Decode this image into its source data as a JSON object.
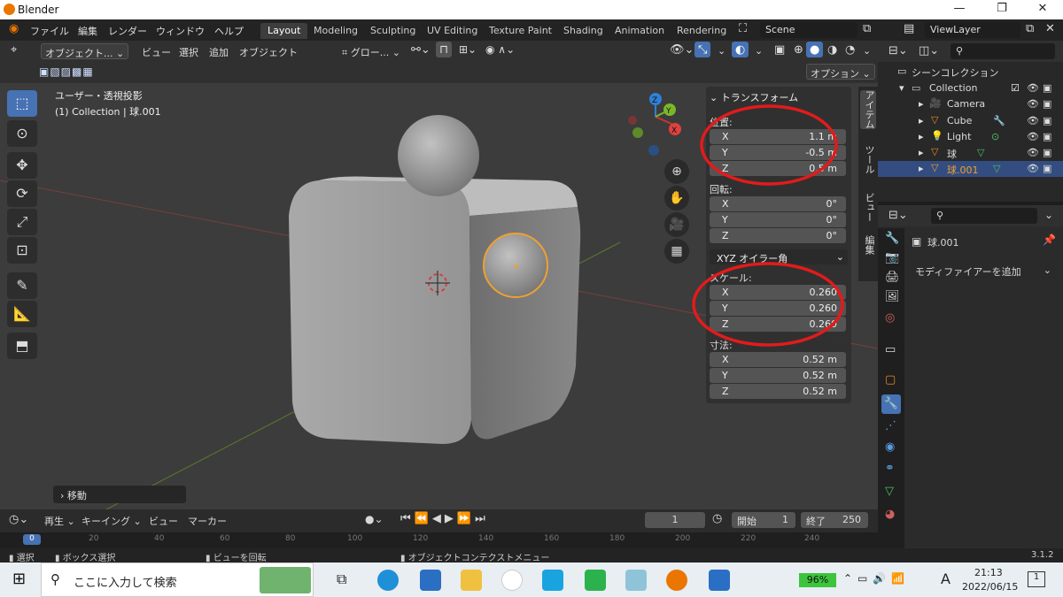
{
  "window": {
    "title": "Blender",
    "minimize": "—",
    "maximize": "❐",
    "close": "✕"
  },
  "menu": {
    "items": [
      "ファイル",
      "編集",
      "レンダー",
      "ウィンドウ",
      "ヘルプ"
    ],
    "workspaces": [
      "Layout",
      "Modeling",
      "Sculpting",
      "UV Editing",
      "Texture Paint",
      "Shading",
      "Animation",
      "Rendering"
    ],
    "active_workspace": "Layout",
    "scene": "Scene",
    "view_layer": "ViewLayer"
  },
  "viewport_header": {
    "mode": "オブジェクト...",
    "menus": [
      "ビュー",
      "選択",
      "追加",
      "オブジェクト"
    ],
    "transform_orientation": "グロー...",
    "options": "オプション"
  },
  "viewport": {
    "view_name": "ユーザー・透視投影",
    "context": "(1) Collection | 球.001",
    "last_operator": "移動",
    "gizmo_axes": {
      "x": "X",
      "y": "Y",
      "z": "Z"
    }
  },
  "npanel": {
    "header": "トランスフォーム",
    "location_label": "位置:",
    "location": [
      {
        "axis": "X",
        "value": "1.1 m"
      },
      {
        "axis": "Y",
        "value": "-0.5 m"
      },
      {
        "axis": "Z",
        "value": "0.5 m"
      }
    ],
    "rotation_label": "回転:",
    "rotation": [
      {
        "axis": "X",
        "value": "0°"
      },
      {
        "axis": "Y",
        "value": "0°"
      },
      {
        "axis": "Z",
        "value": "0°"
      }
    ],
    "rotation_mode": "XYZ オイラー角",
    "scale_label": "スケール:",
    "scale": [
      {
        "axis": "X",
        "value": "0.260"
      },
      {
        "axis": "Y",
        "value": "0.260"
      },
      {
        "axis": "Z",
        "value": "0.260"
      }
    ],
    "dimensions_label": "寸法:",
    "dimensions": [
      {
        "axis": "X",
        "value": "0.52 m"
      },
      {
        "axis": "Y",
        "value": "0.52 m"
      },
      {
        "axis": "Z",
        "value": "0.52 m"
      }
    ],
    "tabs": [
      "アイテム",
      "ツール",
      "ビュー",
      "編集"
    ]
  },
  "outliner": {
    "root": "シーンコレクション",
    "collection": "Collection",
    "objects": [
      "Camera",
      "Cube",
      "Light",
      "球",
      "球.001"
    ],
    "selected": "球.001"
  },
  "properties": {
    "object_name": "球.001",
    "add_modifier": "モディファイアーを追加"
  },
  "timeline": {
    "menus": [
      "再生",
      "キーイング",
      "ビュー",
      "マーカー"
    ],
    "current_frame": "1",
    "start_label": "開始",
    "start": "1",
    "end_label": "終了",
    "end": "250",
    "ruler": [
      "0",
      "20",
      "40",
      "60",
      "80",
      "100",
      "120",
      "140",
      "160",
      "180",
      "200",
      "220",
      "240"
    ]
  },
  "statusbar": {
    "items": [
      "選択",
      "ボックス選択",
      "ビューを回転",
      "オブジェクトコンテクストメニュー"
    ],
    "version": "3.1.2"
  },
  "taskbar": {
    "search_placeholder": "ここに入力して検索",
    "battery": "96%",
    "time": "21:13",
    "date": "2022/06/15",
    "ime": "A",
    "notifications": "1"
  },
  "colors": {
    "accent": "#4772b3",
    "selection_outline": "#f0a030",
    "annotation_red": "#e21b1b",
    "blender_orange": "#ea7600"
  }
}
